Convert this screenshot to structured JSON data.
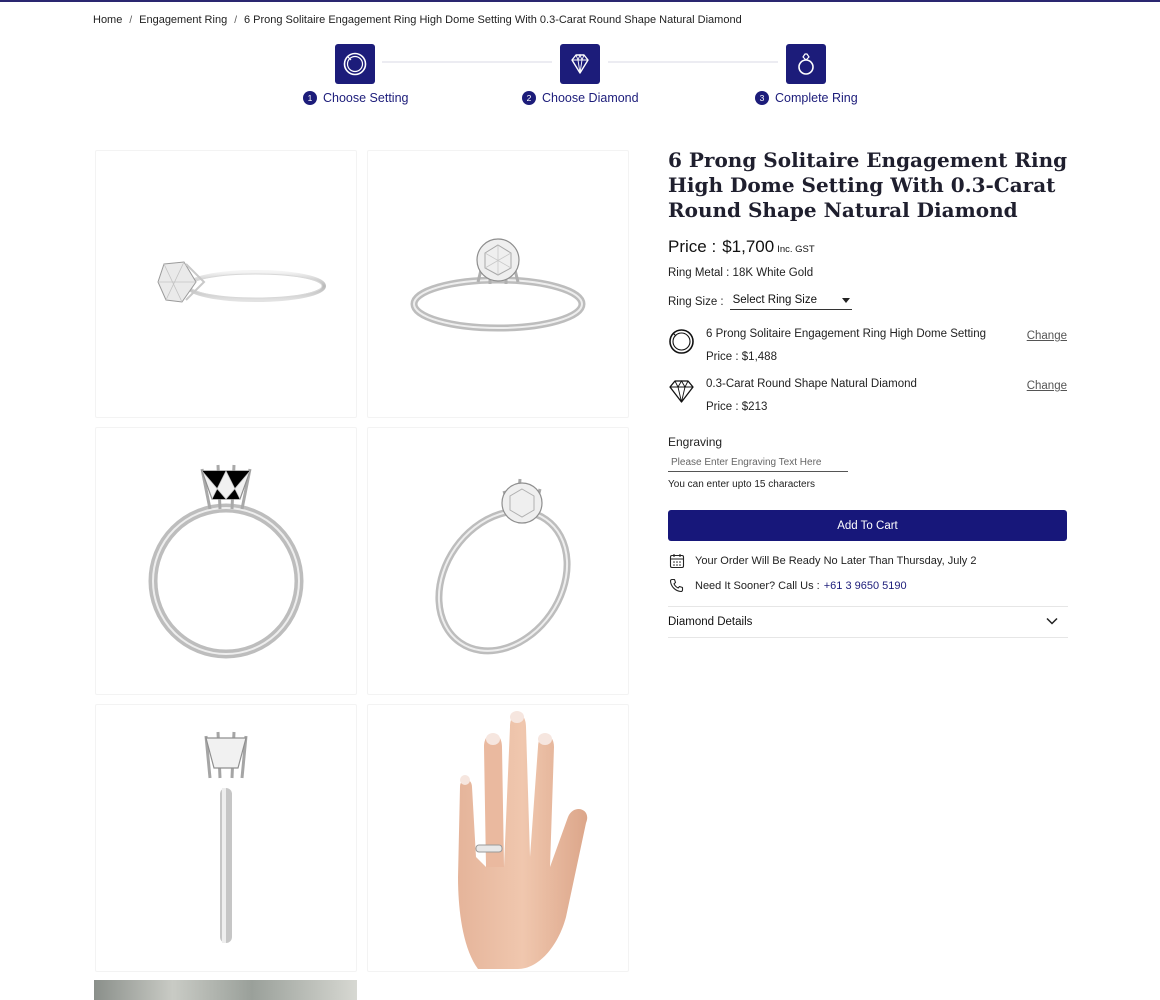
{
  "breadcrumb": {
    "items": [
      "Home",
      "Engagement Ring",
      "6 Prong Solitaire Engagement Ring High Dome Setting With 0.3-Carat Round Shape Natural Diamond"
    ],
    "separator": "/"
  },
  "steps": [
    {
      "num": "1",
      "label": "Choose Setting",
      "icon": "ring-setting-icon"
    },
    {
      "num": "2",
      "label": "Choose Diamond",
      "icon": "diamond-icon"
    },
    {
      "num": "3",
      "label": "Complete Ring",
      "icon": "complete-ring-icon"
    }
  ],
  "gallery": {
    "images": [
      "ring-side-view",
      "ring-front-view",
      "ring-profile-view",
      "ring-angle-view",
      "ring-top-view",
      "ring-on-hand"
    ]
  },
  "product": {
    "title": "6 Prong Solitaire Engagement Ring High Dome Setting With 0.3-Carat Round Shape Natural Diamond",
    "price_label": "Price :",
    "price_value": "$1,700",
    "price_tax": "Inc. GST",
    "metal": "Ring Metal : 18K White Gold",
    "size_label": "Ring Size :",
    "size_value": "Select Ring Size",
    "components": [
      {
        "name": "6 Prong Solitaire Engagement Ring High Dome Setting",
        "price": "Price : $1,488",
        "change": "Change",
        "icon": "ring-setting-icon"
      },
      {
        "name": "0.3-Carat Round Shape Natural Diamond",
        "price": "Price : $213",
        "change": "Change",
        "icon": "diamond-icon"
      }
    ],
    "engraving_label": "Engraving",
    "engraving_placeholder": "Please Enter Engraving Text Here",
    "engraving_hint": "You can enter upto 15 characters",
    "cart_button": "Add To Cart",
    "ready_text": "Your Order Will Be Ready No Later Than Thursday, July 2",
    "call_text": "Need It Sooner? Call Us :",
    "phone": "+61 3 9650 5190",
    "accordion_label": "Diamond Details"
  },
  "colors": {
    "brand_navy": "#17177a",
    "text": "#222222"
  }
}
